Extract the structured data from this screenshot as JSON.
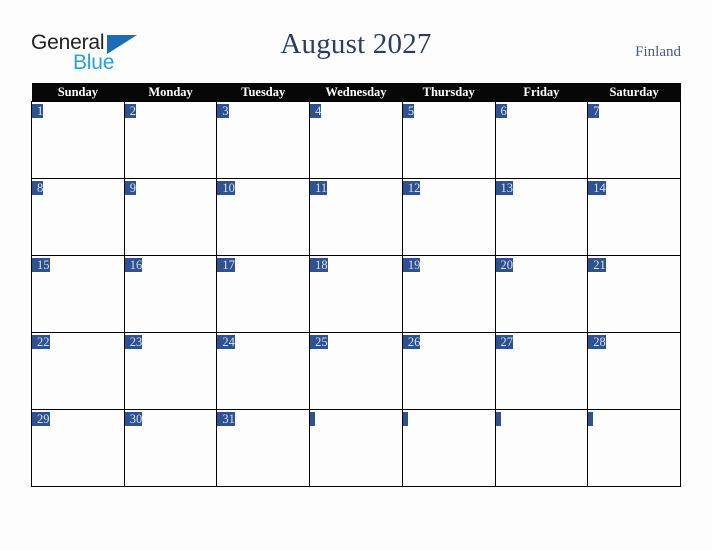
{
  "logo": {
    "word_dark": "General",
    "word_blue": "Blue",
    "triangle_color": "#1b6cb5",
    "dark_color": "#231f20",
    "blue_color": "#2a9ee0"
  },
  "header": {
    "title": "August 2027",
    "country": "Finland",
    "title_color": "#2b3c63",
    "country_color": "#4a5b80"
  },
  "calendar": {
    "month": "August",
    "year": "2027",
    "weekday_headers": [
      "Sunday",
      "Monday",
      "Tuesday",
      "Wednesday",
      "Thursday",
      "Friday",
      "Saturday"
    ],
    "header_bg": "#070707",
    "header_text_color": "#ffffff",
    "day_banner_color": "#2e5290",
    "day_number_color": "#d8dfee",
    "cell_bg": "#fdfdfd",
    "border_color": "#000000",
    "weeks": [
      [
        "1",
        "2",
        "3",
        "4",
        "5",
        "6",
        "7"
      ],
      [
        "8",
        "9",
        "10",
        "11",
        "12",
        "13",
        "14"
      ],
      [
        "15",
        "16",
        "17",
        "18",
        "19",
        "20",
        "21"
      ],
      [
        "22",
        "23",
        "24",
        "25",
        "26",
        "27",
        "28"
      ],
      [
        "29",
        "30",
        "31",
        "",
        "",
        "",
        ""
      ]
    ]
  }
}
